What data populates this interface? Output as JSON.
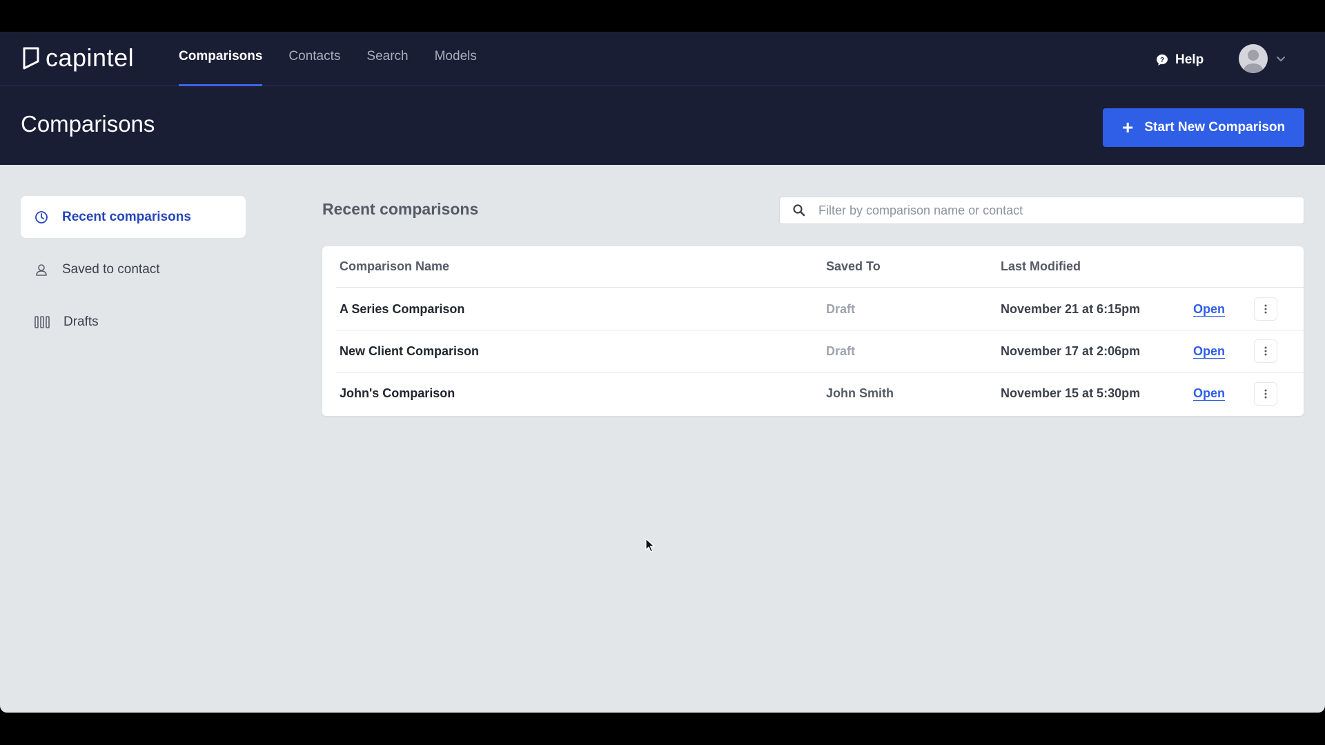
{
  "app": {
    "logo_text": "capintel",
    "nav": [
      {
        "label": "Comparisons",
        "active": true
      },
      {
        "label": "Contacts",
        "active": false
      },
      {
        "label": "Search",
        "active": false
      },
      {
        "label": "Models",
        "active": false
      }
    ],
    "help_label": "Help"
  },
  "page": {
    "title": "Comparisons",
    "new_button_label": "Start New Comparison"
  },
  "sidebar": {
    "items": [
      {
        "label": "Recent comparisons",
        "icon": "clock-icon",
        "active": true
      },
      {
        "label": "Saved to contact",
        "icon": "person-icon",
        "active": false
      },
      {
        "label": "Drafts",
        "icon": "drafts-icon",
        "active": false
      }
    ]
  },
  "main": {
    "section_title": "Recent comparisons",
    "filter_placeholder": "Filter by comparison name or contact",
    "columns": [
      "Comparison Name",
      "Saved To",
      "Last Modified"
    ],
    "rows": [
      {
        "name": "A Series Comparison",
        "saved_to": "Draft",
        "modified": "November 21 at 6:15pm",
        "action": "Open"
      },
      {
        "name": "New Client Comparison",
        "saved_to": "Draft",
        "modified": "November 17 at 2:06pm",
        "action": "Open"
      },
      {
        "name": "John's Comparison",
        "saved_to": "John Smith",
        "modified": "November 15 at 5:30pm",
        "action": "Open"
      }
    ]
  },
  "colors": {
    "header_bg": "#1a1e35",
    "accent": "#2f5fe6",
    "page_bg": "#e2e6e9"
  }
}
